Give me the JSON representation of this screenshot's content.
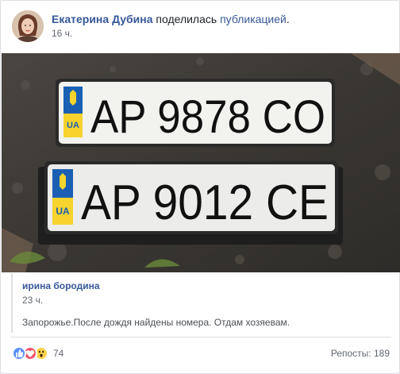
{
  "post": {
    "author_name": "Екатерина Дубина",
    "action_text": "поделилась ",
    "action_link": "публикацией",
    "action_end": ".",
    "time": "16 ч."
  },
  "photo": {
    "plate_top": {
      "country": "UA",
      "number": "AP 9878 CO"
    },
    "plate_bottom": {
      "country": "UA",
      "number": "AP 9012 CE"
    }
  },
  "shared": {
    "author_name": "ирина бородина",
    "time": "23 ч.",
    "text": "Запорожье.После дождя найдены номера. Отдам хозяевам."
  },
  "footer": {
    "reactions": [
      "like-icon",
      "love-icon",
      "wow-icon"
    ],
    "reaction_count": "74",
    "reposts": "Репосты: 189"
  },
  "colors": {
    "link": "#365899",
    "like": "#5890ff",
    "love": "#f25268",
    "wow": "#fcd24c"
  }
}
